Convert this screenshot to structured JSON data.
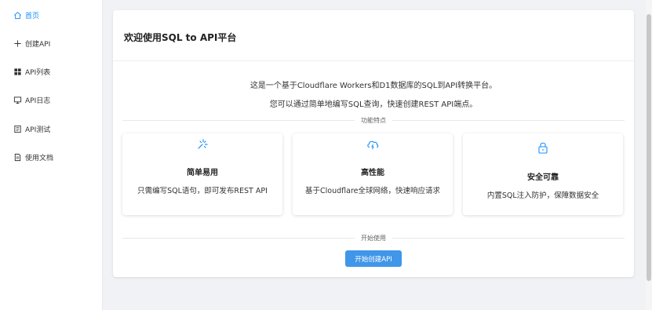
{
  "sidebar": {
    "items": [
      {
        "label": "首页",
        "icon": "home-icon",
        "active": true
      },
      {
        "label": "创建API",
        "icon": "plus-icon",
        "active": false
      },
      {
        "label": "API列表",
        "icon": "grid-icon",
        "active": false
      },
      {
        "label": "API日志",
        "icon": "monitor-icon",
        "active": false
      },
      {
        "label": "API测试",
        "icon": "document-icon",
        "active": false
      },
      {
        "label": "使用文档",
        "icon": "file-icon",
        "active": false
      }
    ]
  },
  "card": {
    "title": "欢迎使用SQL to API平台",
    "intro_line1": "这是一个基于Cloudflare Workers和D1数据库的SQL到API转换平台。",
    "intro_line2": "您可以通过简单地编写SQL查询，快速创建REST API端点。",
    "features_divider": "功能特点",
    "features": [
      {
        "icon": "sparkle-icon",
        "title": "简单易用",
        "desc": "只需编写SQL语句，即可发布REST API"
      },
      {
        "icon": "cloud-icon",
        "title": "高性能",
        "desc": "基于Cloudflare全球网络，快速响应请求"
      },
      {
        "icon": "lock-icon",
        "title": "安全可靠",
        "desc": "内置SQL注入防护，保障数据安全"
      }
    ],
    "start_divider": "开始使用",
    "start_button": "开始创建API"
  },
  "colors": {
    "accent": "#1890ff",
    "button": "#4096e8",
    "background": "#f0f2f5"
  }
}
